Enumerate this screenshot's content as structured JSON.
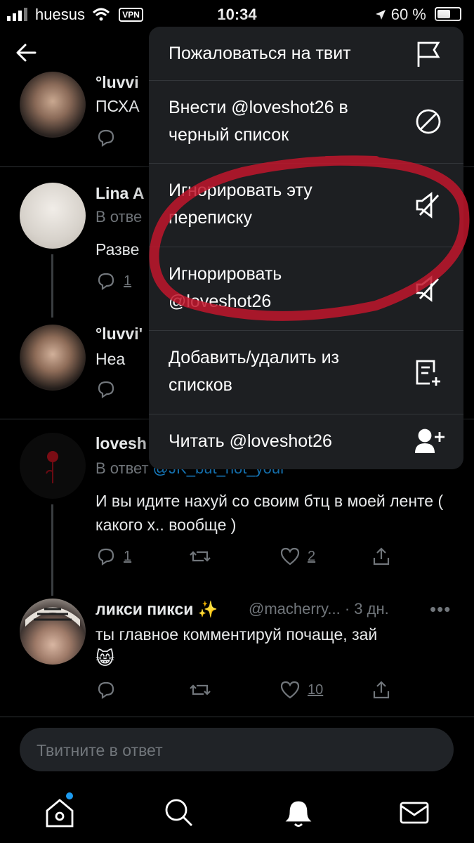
{
  "status_bar": {
    "carrier": "huesus",
    "vpn": "VPN",
    "time": "10:34",
    "battery": "60 %"
  },
  "tweets": [
    {
      "name": "°luvvi",
      "text": "ПСХА"
    },
    {
      "name": "Lina A",
      "reply_prefix": "В отве",
      "text": "Разве",
      "reply_count": "1"
    },
    {
      "name": "°luvvi'",
      "text": "Неа"
    },
    {
      "name": "lovesh",
      "reply_prefix": "В ответ",
      "reply_to": "@JK_but_not_your",
      "text": "И вы идите нахуй со своим бтц в моей ленте ( какого х.. вообще )",
      "reply_count": "1",
      "like_count": "2"
    },
    {
      "name": "ликси пикси",
      "name_emoji": "✨",
      "handle": "@macherry...",
      "time": "· 3 дн.",
      "text": "ты главное комментируй почаще, зай",
      "emoji": "😸",
      "like_count": "10"
    }
  ],
  "menu": {
    "items": [
      {
        "label": "Пожаловаться на твит",
        "icon": "flag-icon"
      },
      {
        "label": "Внести @loveshot26 в черный список",
        "icon": "block-icon"
      },
      {
        "label": "Игнорировать эту переписку",
        "icon": "mute-icon"
      },
      {
        "label": "Игнорировать @loveshot26",
        "icon": "mute-icon"
      },
      {
        "label": "Добавить/удалить из списков",
        "icon": "list-add-icon"
      },
      {
        "label": "Читать @loveshot26",
        "icon": "follow-icon"
      }
    ]
  },
  "reply_input": {
    "placeholder": "Твитните в ответ"
  },
  "colors": {
    "accent": "#1d9bf0",
    "annotation": "#c0162c"
  }
}
